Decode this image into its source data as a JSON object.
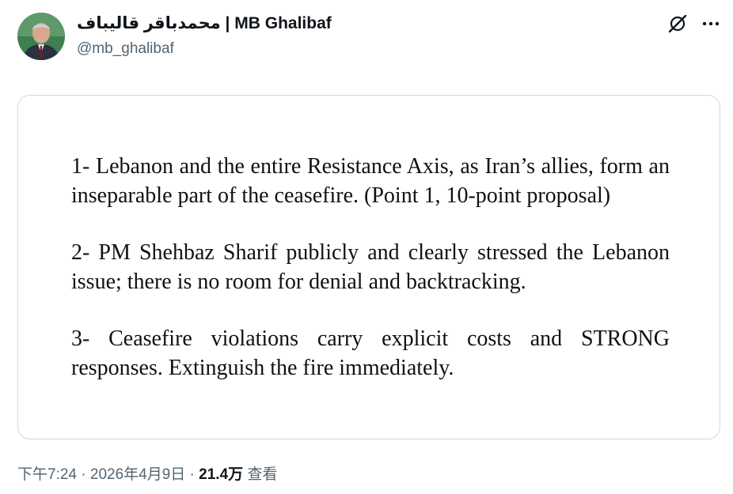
{
  "author": {
    "display_name": "محمدباقر قالیباف | MB Ghalibaf",
    "handle": "@mb_ghalibaf",
    "avatar_icon": "profile-photo"
  },
  "header_icons": [
    "grok-icon",
    "more-icon"
  ],
  "image_card": {
    "paragraphs": [
      "1- Lebanon and the entire Resistance Axis, as Iran’s allies, form an inseparable part of the ceasefire. (Point 1, 10-point proposal)",
      "2- PM Shehbaz Sharif publicly and clearly stressed the Lebanon issue; there is no room for denial and backtracking.",
      "3- Ceasefire violations carry explicit costs and STRONG responses. Extinguish the fire immediately."
    ]
  },
  "meta": {
    "time": "下午7:24",
    "separator": " · ",
    "date": "2026年4月9日",
    "views_count": "21.4万",
    "views_label": "查看"
  },
  "colors": {
    "text_primary": "#0f1419",
    "text_secondary": "#536471",
    "border": "#cfd9de"
  }
}
